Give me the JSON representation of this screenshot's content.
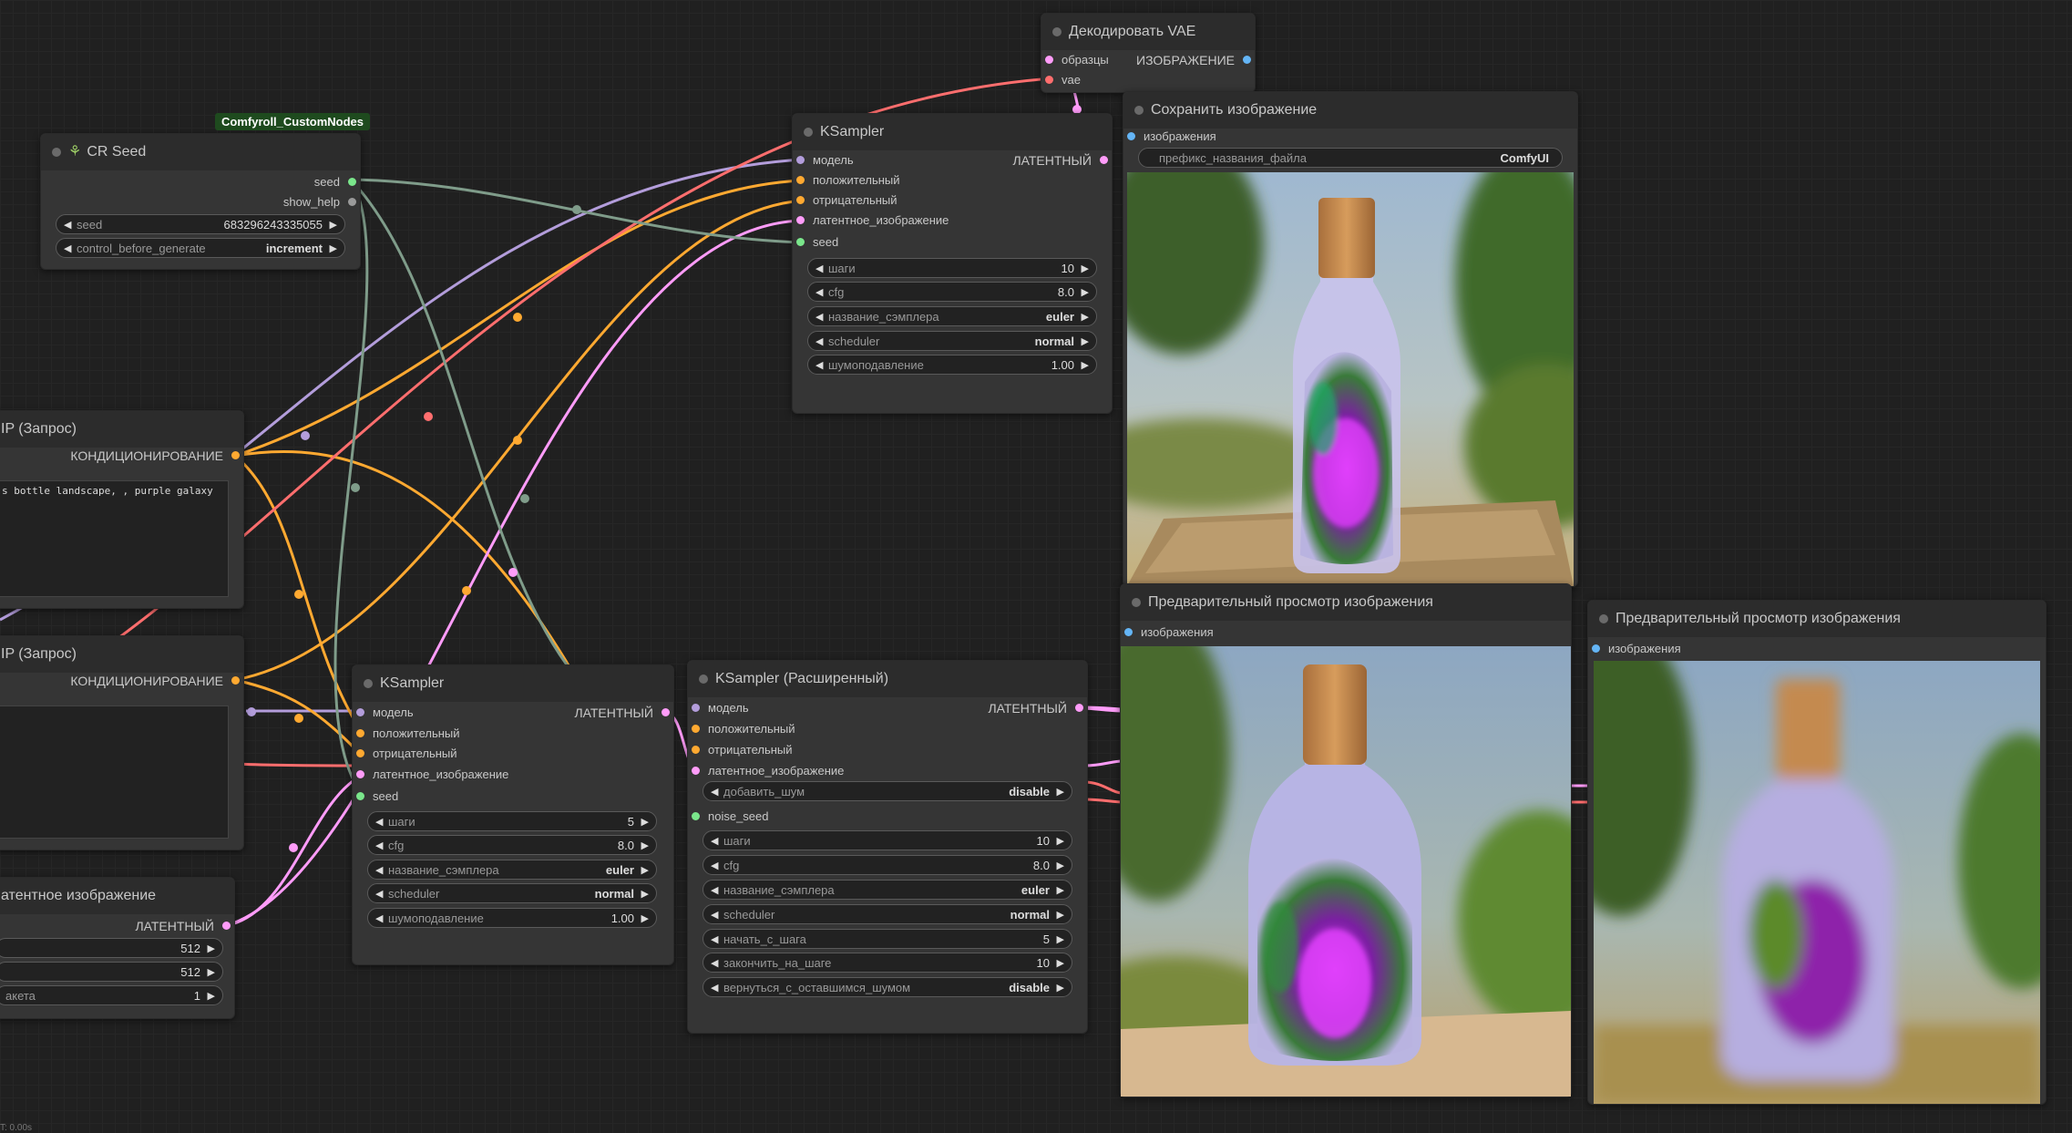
{
  "colors": {
    "model": "#b39ddb",
    "conditioning": "#ffa931",
    "latent": "#ff9cf9",
    "vae": "#ff6e6e",
    "int": "#7ae68b",
    "image": "#64b5f6",
    "wire_seed": "#7f9c8a"
  },
  "badge": "Comfyroll_CustomNodes",
  "cr_seed": {
    "title": "CR Seed",
    "title_icon": "sprout-icon",
    "outputs": [
      "seed",
      "show_help"
    ],
    "widgets": [
      {
        "name": "seed",
        "value": "683296243335055"
      },
      {
        "name": "control_before_generate",
        "value": "increment"
      }
    ]
  },
  "clip1": {
    "title": "IP (Запрос)",
    "output": "КОНДИЦИОНИРОВАНИЕ",
    "text": "s bottle landscape, , purple galaxy"
  },
  "clip2": {
    "title": "IP (Запрос)",
    "output": "КОНДИЦИОНИРОВАНИЕ",
    "text": ""
  },
  "latent_node": {
    "title": "атентное изображение",
    "output": "ЛАТЕНТНЫЙ",
    "widgets": [
      {
        "name": "",
        "value": "512"
      },
      {
        "name": "",
        "value": "512"
      },
      {
        "name": "акета",
        "value": "1"
      }
    ]
  },
  "vae_decode": {
    "title": "Декодировать VAE",
    "inputs": [
      "образцы",
      "vae"
    ],
    "output": "ИЗОБРАЖЕНИЕ"
  },
  "ksampler_top": {
    "title": "KSampler",
    "inputs": [
      "модель",
      "положительный",
      "отрицательный",
      "латентное_изображение",
      "seed"
    ],
    "output": "ЛАТЕНТНЫЙ",
    "widgets": [
      {
        "name": "шаги",
        "value": "10"
      },
      {
        "name": "cfg",
        "value": "8.0"
      },
      {
        "name": "название_сэмплера",
        "value": "euler"
      },
      {
        "name": "scheduler",
        "value": "normal"
      },
      {
        "name": "шумоподавление",
        "value": "1.00"
      }
    ]
  },
  "ksampler_bottom": {
    "title": "KSampler",
    "inputs": [
      "модель",
      "положительный",
      "отрицательный",
      "латентное_изображение",
      "seed"
    ],
    "output": "ЛАТЕНТНЫЙ",
    "widgets": [
      {
        "name": "шаги",
        "value": "5"
      },
      {
        "name": "cfg",
        "value": "8.0"
      },
      {
        "name": "название_сэмплера",
        "value": "euler"
      },
      {
        "name": "scheduler",
        "value": "normal"
      },
      {
        "name": "шумоподавление",
        "value": "1.00"
      }
    ]
  },
  "ksampler_adv": {
    "title": "KSampler (Расширенный)",
    "inputs": [
      "модель",
      "положительный",
      "отрицательный",
      "латентное_изображение"
    ],
    "output": "ЛАТЕНТНЫЙ",
    "widget_add_noise": {
      "name": "добавить_шум",
      "value": "disable"
    },
    "noise_seed_input": "noise_seed",
    "widgets": [
      {
        "name": "шаги",
        "value": "10"
      },
      {
        "name": "cfg",
        "value": "8.0"
      },
      {
        "name": "название_сэмплера",
        "value": "euler"
      },
      {
        "name": "scheduler",
        "value": "normal"
      },
      {
        "name": "начать_с_шага",
        "value": "5"
      },
      {
        "name": "закончить_на_шаге",
        "value": "10"
      },
      {
        "name": "вернуться_с_оставшимся_шумом",
        "value": "disable"
      }
    ]
  },
  "save_image": {
    "title": "Сохранить изображение",
    "input": "изображения",
    "widget": {
      "name": "префикс_названия_файла",
      "value": "ComfyUI"
    }
  },
  "preview1": {
    "title": "Предварительный просмотр изображения",
    "input": "изображения"
  },
  "preview2": {
    "title": "Предварительный просмотр изображения",
    "input": "изображения"
  },
  "status": "T: 0.00s"
}
